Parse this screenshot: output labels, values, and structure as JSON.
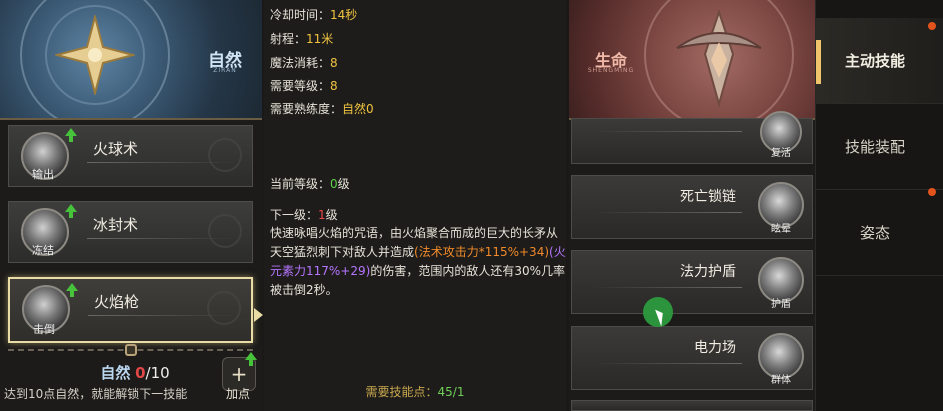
{
  "left_panel": {
    "banner": {
      "title": "自然",
      "subtitle": "ZIRAN"
    },
    "skills": [
      {
        "name": "火球术",
        "tag": "输出",
        "selected": false
      },
      {
        "name": "冰封术",
        "tag": "冻结",
        "selected": false
      },
      {
        "name": "火焰枪",
        "tag": "击倒",
        "selected": true
      }
    ],
    "points": {
      "label": "自然",
      "current": "0",
      "max": "/10"
    },
    "unlock_hint": "达到10点自然，就能解锁下一技能",
    "add_point_label": "加点",
    "add_point_symbol": "+"
  },
  "details": {
    "cooldown_label": "冷却时间：",
    "cooldown_value": "14秒",
    "range_label": "射程：",
    "range_value": "11米",
    "mana_label": "魔法消耗：",
    "mana_value": "8",
    "req_level_label": "需要等级：",
    "req_level_value": "8",
    "req_prof_label": "需要熟练度：",
    "req_prof_value": "自然0",
    "current_level_label": "当前等级：",
    "current_level_value": "0",
    "current_level_suffix": "级",
    "next_level_label": "下一级：",
    "next_level_value": "1",
    "next_level_suffix": "级",
    "desc_part1": "快速咏唱火焰的咒语，由火焰聚合而成的巨大的长矛从天空猛烈刺下对敌人并造成",
    "desc_orange": "(法术攻击力*115%+34)",
    "desc_purple": "(火元素力117%+29)",
    "desc_part2": "的伤害，范围内的敌人还有30%几率被击倒2秒。",
    "need_points_label": "需要技能点：",
    "need_points_value": "45/1"
  },
  "right_panel": {
    "banner": {
      "title": "生命",
      "subtitle": "SHENGMING"
    },
    "skills": [
      {
        "name": "",
        "tag": "复活"
      },
      {
        "name": "死亡锁链",
        "tag": "眩晕"
      },
      {
        "name": "法力护盾",
        "tag": "护盾"
      },
      {
        "name": "电力场",
        "tag": "群体"
      }
    ]
  },
  "tabs": [
    {
      "label": "主动技能",
      "active": true
    },
    {
      "label": "技能装配",
      "active": false
    },
    {
      "label": "姿态",
      "active": false
    }
  ],
  "colors": {
    "accent_gold": "#efc340",
    "green": "#5fd04a",
    "red": "#e84a4a",
    "orange": "#f08a2a",
    "purple": "#b575ff"
  }
}
